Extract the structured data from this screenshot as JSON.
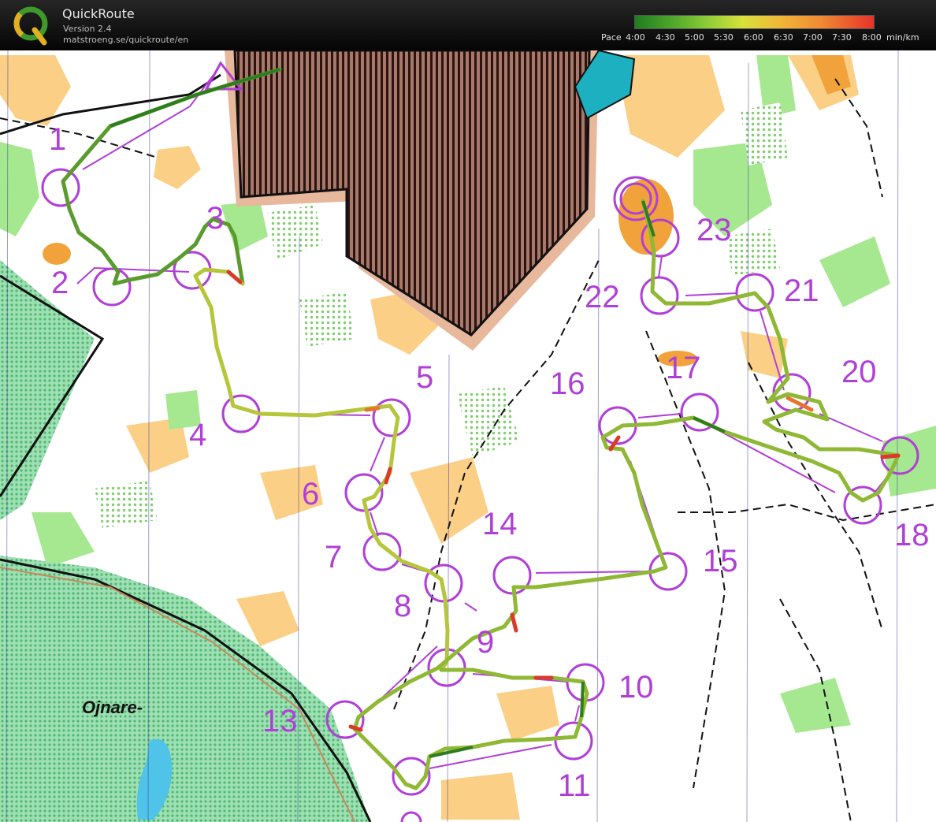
{
  "app": {
    "title": "QuickRoute",
    "version": "Version 2.4",
    "url": "matstroeng.se/quickroute/en"
  },
  "pace_scale": {
    "label": "Pace",
    "ticks": [
      "4:00",
      "4:30",
      "5:00",
      "5:30",
      "6:00",
      "6:30",
      "7:00",
      "7:30",
      "8:00"
    ],
    "unit": "min/km",
    "colors": [
      "#1f7d1f",
      "#4ca52a",
      "#8ccc36",
      "#d7e13a",
      "#f2b338",
      "#f08a33",
      "#e6322a"
    ]
  },
  "map": {
    "place_name": "Ojnare-",
    "course_color": "#b03fd8",
    "route_colors": {
      "fast": "#2e7d1e",
      "medium": "#c6d13a",
      "slow": "#d93a2a"
    },
    "controls": [
      "1",
      "2",
      "3",
      "4",
      "5",
      "6",
      "7",
      "8",
      "9",
      "10",
      "11",
      "13",
      "14",
      "15",
      "16",
      "17",
      "18",
      "20",
      "21",
      "22",
      "23"
    ]
  }
}
